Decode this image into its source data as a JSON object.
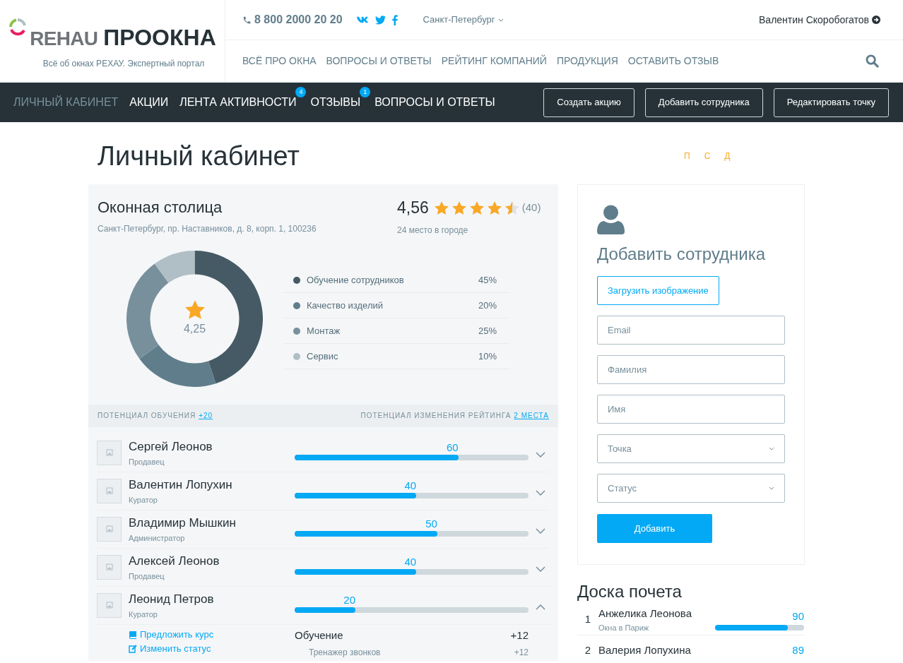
{
  "header": {
    "logo_brand": "REHAU",
    "logo_name": "ПРООКНА",
    "tagline": "Всё об окнах РЕХАУ. Экспертный портал",
    "phone": "8 800 2000 20 20",
    "city": "Санкт-Петербург",
    "user": "Валентин Скоробогатов",
    "nav": [
      "ВСЁ ПРО ОКНА",
      "ВОПРОСЫ И ОТВЕТЫ",
      "РЕЙТИНГ КОМПАНИЙ",
      "ПРОДУКЦИЯ",
      "ОСТАВИТЬ ОТЗЫВ"
    ]
  },
  "tabs": [
    {
      "label": "ЛИЧНЫЙ КАБИНЕТ",
      "selected": true
    },
    {
      "label": "АКЦИИ",
      "selected": false
    },
    {
      "label": "ЛЕНТА АКТИВНОСТИ",
      "selected": false,
      "badge": "4"
    },
    {
      "label": "ОТЗЫВЫ",
      "selected": false,
      "badge": "1"
    },
    {
      "label": "ВОПРОСЫ И ОТВЕТЫ",
      "selected": false
    }
  ],
  "actions": [
    "Создать акцию",
    "Добавить сотрудника",
    "Редактировать точку"
  ],
  "page_title": "Личный кабинет",
  "letters": [
    "П",
    "С",
    "Д"
  ],
  "company": {
    "name": "Оконная столица",
    "address": "Санкт-Петербург, пр. Наставников, д. 8, корп. 1, 100236",
    "rating": "4,56",
    "stars": 4.5,
    "reviews": "(40)",
    "place": "24 место в городе",
    "center_value": "4,25",
    "chart_data": {
      "type": "donut",
      "categories": [
        "Обучение сотрудников",
        "Качество изделий",
        "Монтаж",
        "Сервис"
      ],
      "values": [
        45,
        20,
        25,
        10
      ],
      "colors": [
        "#455a64",
        "#607d8b",
        "#78909c",
        "#b0bec5"
      ],
      "value_labels": [
        "45%",
        "20%",
        "25%",
        "10%"
      ]
    },
    "potential_label": "ПОТЕНЦИАЛ ОБУЧЕНИЯ",
    "potential_link": "+20",
    "change_label": "ПОТЕНЦИАЛ ИЗМЕНЕНИЯ РЕЙТИНГА",
    "change_link": "2 МЕСТА"
  },
  "employees": [
    {
      "name": "Сергей Леонов",
      "role": "Продавец",
      "score": "60",
      "level": 0.7,
      "expanded": false
    },
    {
      "name": "Валентин Лопухин",
      "role": "Куратор",
      "score": "40",
      "level": 0.52,
      "expanded": false
    },
    {
      "name": "Владимир Мышкин",
      "role": "Администратор",
      "score": "50",
      "level": 0.61,
      "expanded": false
    },
    {
      "name": "Алексей Леонов",
      "role": "Продавец",
      "score": "40",
      "level": 0.52,
      "expanded": false
    },
    {
      "name": "Леонид Петров",
      "role": "Куратор",
      "score": "20",
      "level": 0.26,
      "expanded": true,
      "links": [
        {
          "kind": "book",
          "label": "Предложить курс"
        },
        {
          "kind": "edit",
          "label": "Изменить статус"
        }
      ],
      "details": [
        {
          "kind": "group",
          "label": "Обучение",
          "value": "+12"
        },
        {
          "kind": "item",
          "label": "Тренажер звонков",
          "value": "+12"
        }
      ]
    }
  ],
  "add_form": {
    "title": "Добавить сотрудника",
    "upload": "Загрузить изображение",
    "fields": [
      {
        "kind": "text",
        "placeholder": "Email"
      },
      {
        "kind": "text",
        "placeholder": "Фамилия"
      },
      {
        "kind": "text",
        "placeholder": "Имя"
      },
      {
        "kind": "select",
        "placeholder": "Точка"
      },
      {
        "kind": "select",
        "placeholder": "Статус"
      }
    ],
    "submit": "Добавить"
  },
  "honor": {
    "title": "Доска почета",
    "rows": [
      {
        "rank": "1",
        "name": "Анжелика Леонова",
        "company": "Окна в Париж",
        "score": "90",
        "level": 0.82
      },
      {
        "rank": "2",
        "name": "Валерия Лопухина",
        "score": "89"
      }
    ]
  }
}
